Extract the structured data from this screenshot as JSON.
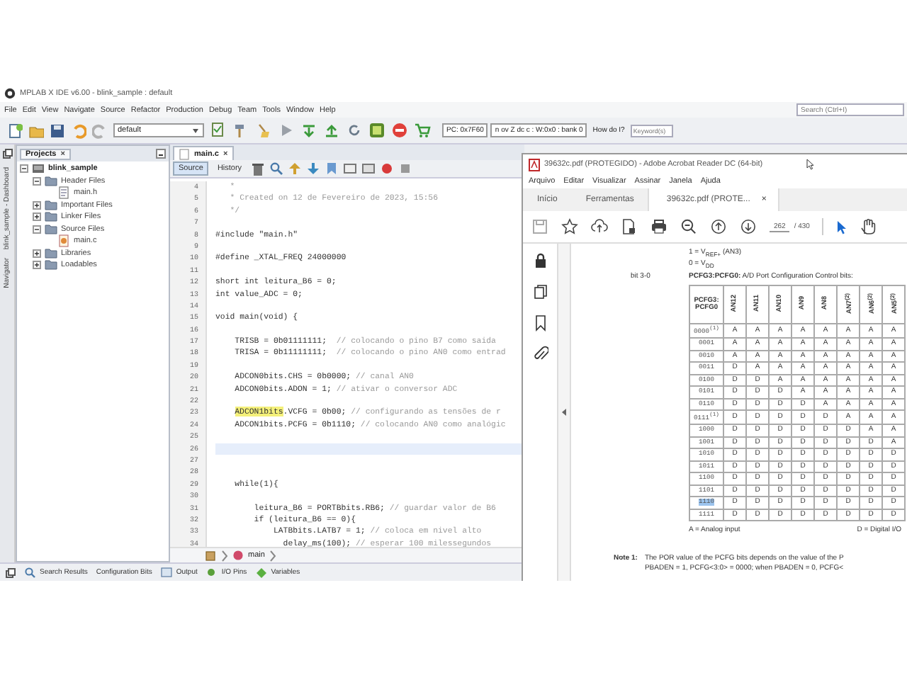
{
  "ide": {
    "title": "MPLAB X IDE v6.00 - blink_sample : default",
    "menu": [
      "File",
      "Edit",
      "View",
      "Navigate",
      "Source",
      "Refactor",
      "Production",
      "Debug",
      "Team",
      "Tools",
      "Window",
      "Help"
    ],
    "search": {
      "placeholder": "Search (Ctrl+I)"
    },
    "config": "default",
    "status": [
      "PC: 0x7F60",
      "n ov Z dc c : W:0x0 : bank 0"
    ],
    "help": {
      "label": "How do I?",
      "placeholder": "Keyword(s)"
    },
    "side_tabs": [
      "blink_sample - Dashboard",
      "Navigator"
    ],
    "projects": {
      "tab": "Projects",
      "close": "×",
      "tree": [
        {
          "label": "blink_sample",
          "kind": "project",
          "expanded": true,
          "children": [
            {
              "label": "Header Files",
              "kind": "folder",
              "expanded": true,
              "children": [
                {
                  "label": "main.h",
                  "kind": "header"
                }
              ]
            },
            {
              "label": "Important Files",
              "kind": "folder",
              "expanded": false
            },
            {
              "label": "Linker Files",
              "kind": "folder",
              "expanded": false
            },
            {
              "label": "Source Files",
              "kind": "folder",
              "expanded": true,
              "children": [
                {
                  "label": "main.c",
                  "kind": "source"
                }
              ]
            },
            {
              "label": "Libraries",
              "kind": "folder",
              "expanded": false
            },
            {
              "label": "Loadables",
              "kind": "folder",
              "expanded": false
            }
          ]
        }
      ]
    },
    "editor": {
      "tab": "main.c",
      "close": "×",
      "views": [
        {
          "label": "Source",
          "selected": true
        },
        {
          "label": "History",
          "selected": false
        }
      ],
      "lines": [
        {
          "n": "4",
          "comment": "   *",
          "current": false
        },
        {
          "n": "5",
          "comment": "   * Created on 12 de Fevereiro de 2023, 15:56",
          "current": false
        },
        {
          "n": "6",
          "comment": "   */",
          "current": false
        },
        {
          "n": "7",
          "current": false
        },
        {
          "n": "8",
          "code": "#include \"main.h\"",
          "current": false
        },
        {
          "n": "9",
          "current": false
        },
        {
          "n": "10",
          "code": "#define _XTAL_FREQ 24000000",
          "current": false
        },
        {
          "n": "11",
          "current": false
        },
        {
          "n": "12",
          "code": "short int leitura_B6 = 0;",
          "current": false
        },
        {
          "n": "13",
          "code": "int value_ADC = 0;",
          "current": false
        },
        {
          "n": "14",
          "current": false
        },
        {
          "n": "15",
          "code": "void main(void) {",
          "current": false
        },
        {
          "n": "16",
          "current": false
        },
        {
          "n": "17",
          "code": "    TRISB = 0b01111111;  ",
          "comment": "// colocando o pino B7 como saida",
          "current": false
        },
        {
          "n": "18",
          "code": "    TRISA = 0b11111111;  ",
          "comment": "// colocando o pino AN0 como entrad",
          "current": false
        },
        {
          "n": "19",
          "current": false
        },
        {
          "n": "20",
          "code": "    ADCON0bits.CHS = 0b0000; ",
          "comment": "// canal AN0",
          "current": false
        },
        {
          "n": "21",
          "code": "    ADCON0bits.ADON = 1; ",
          "comment": "// ativar o conversor ADC",
          "current": false
        },
        {
          "n": "22",
          "current": false
        },
        {
          "n": "23",
          "mark": "ADCON1bits",
          "code": ".VCFG = 0b00; ",
          "comment": "// configurando as tensões de r",
          "current": false
        },
        {
          "n": "24",
          "code": "    ADCON1bits.PCFG = 0b1110; ",
          "comment": "// colocando AN0 como analógic",
          "current": false
        },
        {
          "n": "25",
          "current": false
        },
        {
          "n": "26",
          "current": true
        },
        {
          "n": "27",
          "current": false
        },
        {
          "n": "28",
          "current": false
        },
        {
          "n": "29",
          "code": "    while(1){",
          "current": false
        },
        {
          "n": "30",
          "current": false
        },
        {
          "n": "31",
          "code": "        leitura_B6 = PORTBbits.RB6; ",
          "comment": "// guardar valor de B6",
          "current": false
        },
        {
          "n": "32",
          "code": "        if (leitura_B6 == 0){",
          "current": false
        },
        {
          "n": "33",
          "code": "            LATBbits.LATB7 = 1; ",
          "comment": "// coloca em nivel alto",
          "current": false
        },
        {
          "n": "34",
          "code": "              delay_ms(100); ",
          "comment": "// esperar 100 milessegundos",
          "current": false
        }
      ],
      "breadcrumb": "main"
    },
    "bottom_tabs": [
      "Search Results",
      "Configuration Bits",
      "Output",
      "I/O Pins",
      "Variables"
    ]
  },
  "reader": {
    "title": "39632c.pdf (PROTEGIDO) - Adobe Acrobat Reader DC (64-bit)",
    "menu": [
      "Arquivo",
      "Editar",
      "Visualizar",
      "Assinar",
      "Janela",
      "Ajuda"
    ],
    "tabs": [
      {
        "label": "Início",
        "selected": false
      },
      {
        "label": "Ferramentas",
        "selected": false
      },
      {
        "label": "39632c.pdf (PROTE...",
        "selected": true,
        "close": "×"
      }
    ],
    "page": "262",
    "pages": "/ 430",
    "doc": {
      "intro": [
        "1 = V$_{REF+}$ (AN3)",
        "0 = V$_{DD}$"
      ],
      "bit": "bit 3-0",
      "heading": "**PCFG3:PCFG0:** A/D Port Configuration Control bits:",
      "table": {
        "columns": [
          "PCFG3: PCFG0",
          "AN12",
          "AN11",
          "AN10",
          "AN9",
          "AN8",
          "AN7$^{(2)}$",
          "AN6$^{(2)}$",
          "AN5$^{(2)}$"
        ],
        "rows": [
          {
            "cells": [
              "0000$^{(1)}$",
              "A",
              "A",
              "A",
              "A",
              "A",
              "A",
              "A",
              "A"
            ],
            "selected": false
          },
          {
            "cells": [
              "0001",
              "A",
              "A",
              "A",
              "A",
              "A",
              "A",
              "A",
              "A"
            ],
            "selected": false
          },
          {
            "cells": [
              "0010",
              "A",
              "A",
              "A",
              "A",
              "A",
              "A",
              "A",
              "A"
            ],
            "selected": false
          },
          {
            "cells": [
              "0011",
              "D",
              "A",
              "A",
              "A",
              "A",
              "A",
              "A",
              "A"
            ],
            "selected": false
          },
          {
            "cells": [
              "0100",
              "D",
              "D",
              "A",
              "A",
              "A",
              "A",
              "A",
              "A"
            ],
            "selected": false
          },
          {
            "cells": [
              "0101",
              "D",
              "D",
              "D",
              "A",
              "A",
              "A",
              "A",
              "A"
            ],
            "selected": false
          },
          {
            "cells": [
              "0110",
              "D",
              "D",
              "D",
              "D",
              "A",
              "A",
              "A",
              "A"
            ],
            "selected": false
          },
          {
            "cells": [
              "0111$^{(1)}$",
              "D",
              "D",
              "D",
              "D",
              "D",
              "A",
              "A",
              "A"
            ],
            "selected": false
          },
          {
            "cells": [
              "1000",
              "D",
              "D",
              "D",
              "D",
              "D",
              "D",
              "A",
              "A"
            ],
            "selected": false
          },
          {
            "cells": [
              "1001",
              "D",
              "D",
              "D",
              "D",
              "D",
              "D",
              "D",
              "A"
            ],
            "selected": false
          },
          {
            "cells": [
              "1010",
              "D",
              "D",
              "D",
              "D",
              "D",
              "D",
              "D",
              "D"
            ],
            "selected": false
          },
          {
            "cells": [
              "1011",
              "D",
              "D",
              "D",
              "D",
              "D",
              "D",
              "D",
              "D"
            ],
            "selected": false
          },
          {
            "cells": [
              "1100",
              "D",
              "D",
              "D",
              "D",
              "D",
              "D",
              "D",
              "D"
            ],
            "selected": false
          },
          {
            "cells": [
              "1101",
              "D",
              "D",
              "D",
              "D",
              "D",
              "D",
              "D",
              "D"
            ],
            "selected": false
          },
          {
            "cells": [
              "1110",
              "D",
              "D",
              "D",
              "D",
              "D",
              "D",
              "D",
              "D"
            ],
            "selected": true
          },
          {
            "cells": [
              "1111",
              "D",
              "D",
              "D",
              "D",
              "D",
              "D",
              "D",
              "D"
            ],
            "selected": false
          }
        ]
      },
      "legend": [
        "A = Analog input",
        "D = Digital I/O"
      ],
      "note_label": "Note 1:",
      "note": [
        "The POR value of the PCFG bits depends on the value of the P",
        "PBADEN = 1, PCFG<3:0> = 0000; when PBADEN = 0, PCFG<"
      ]
    }
  }
}
